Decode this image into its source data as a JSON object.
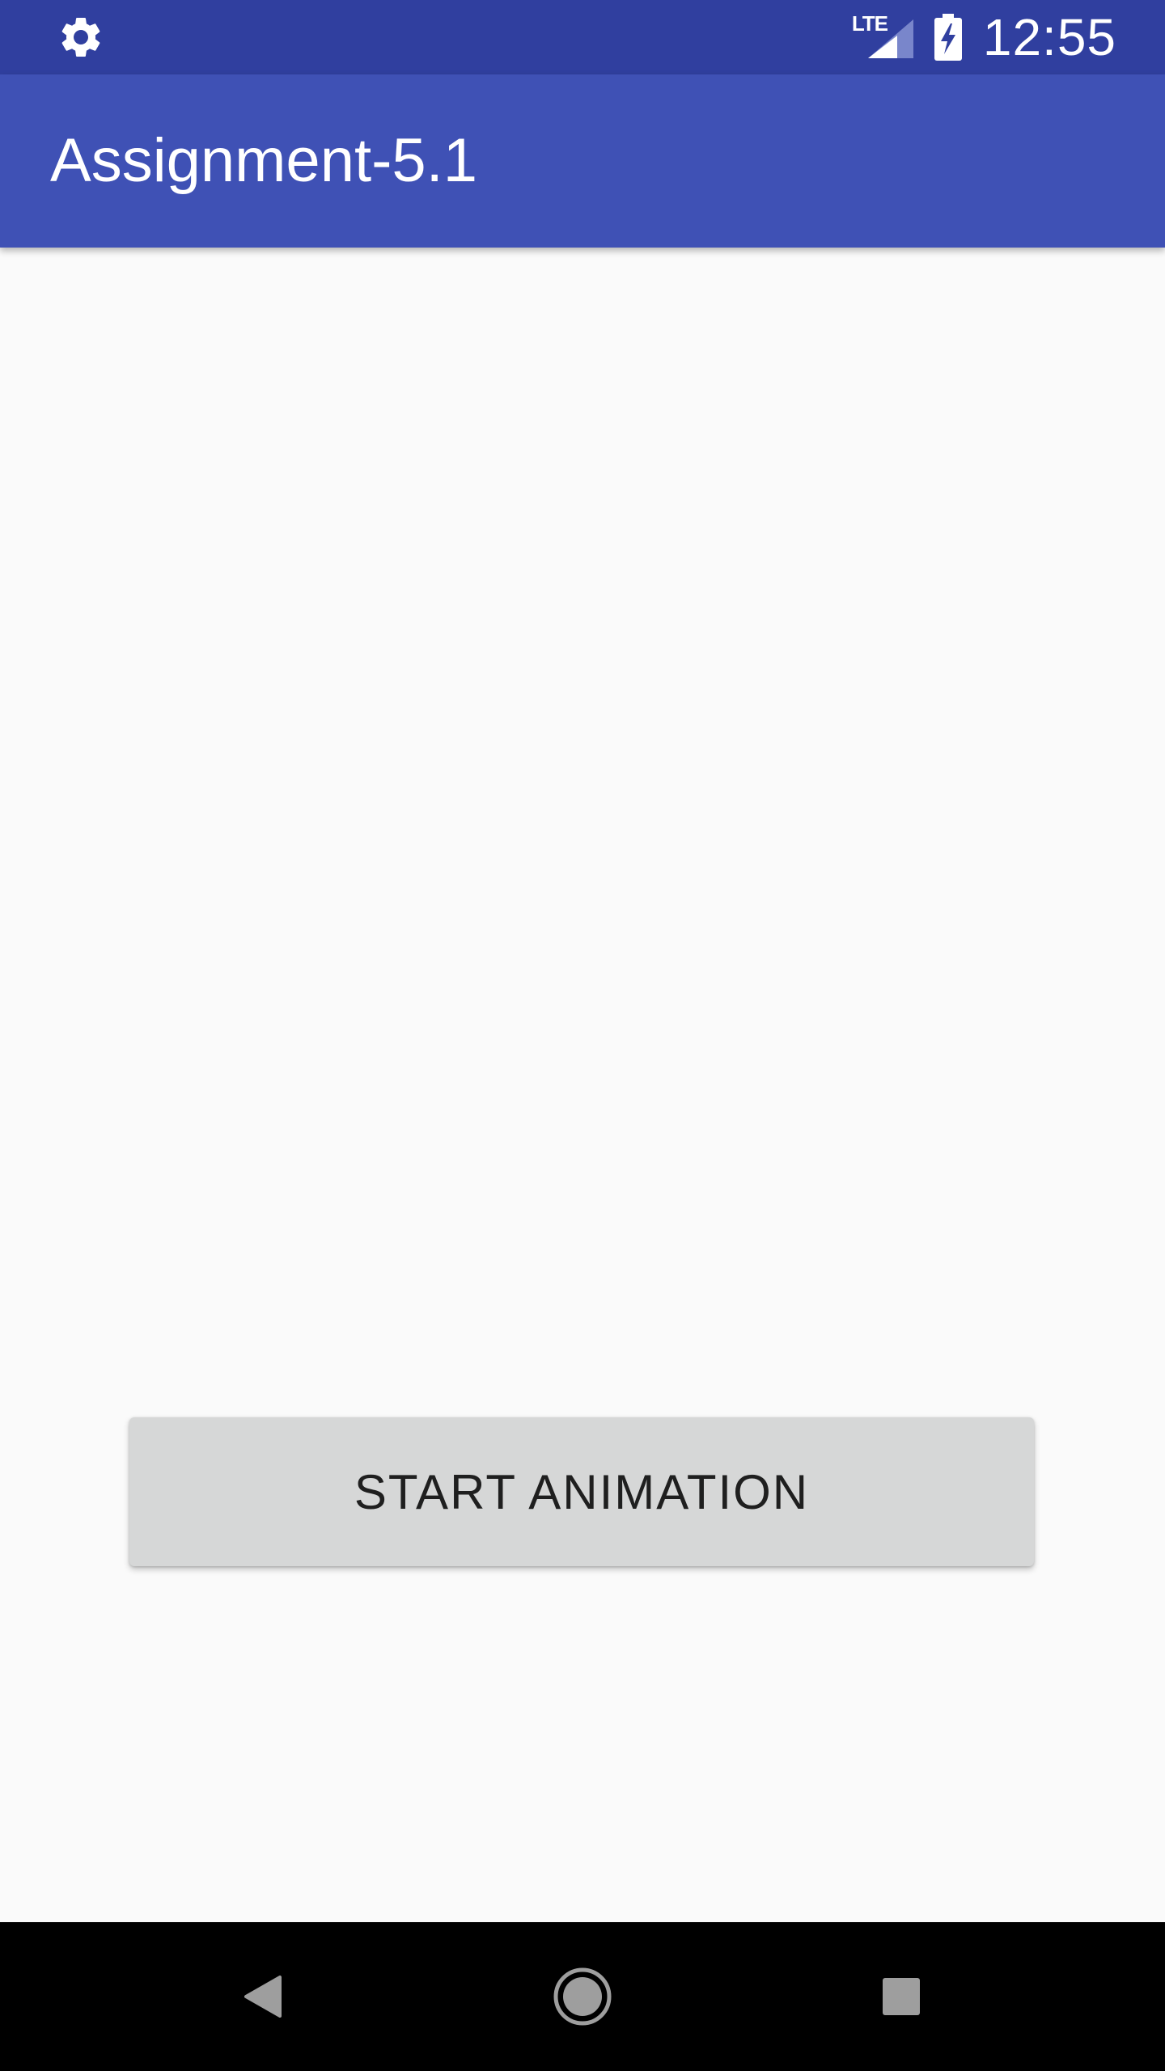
{
  "status_bar": {
    "time": "12:55",
    "network_label": "LTE",
    "left_icon": "gear-icon",
    "signal_icon": "cell-signal-icon",
    "battery_icon": "battery-charging-icon",
    "background_color": "#303f9f"
  },
  "app_bar": {
    "title": "Assignment-5.1",
    "background_color": "#3f51b5"
  },
  "main": {
    "start_button_label": "START ANIMATION",
    "button_color": "#d6d7d7",
    "background_color": "#fafafa"
  },
  "nav_bar": {
    "back_icon": "back-triangle-icon",
    "home_icon": "home-circle-icon",
    "recents_icon": "recents-square-icon",
    "background_color": "#000000"
  }
}
